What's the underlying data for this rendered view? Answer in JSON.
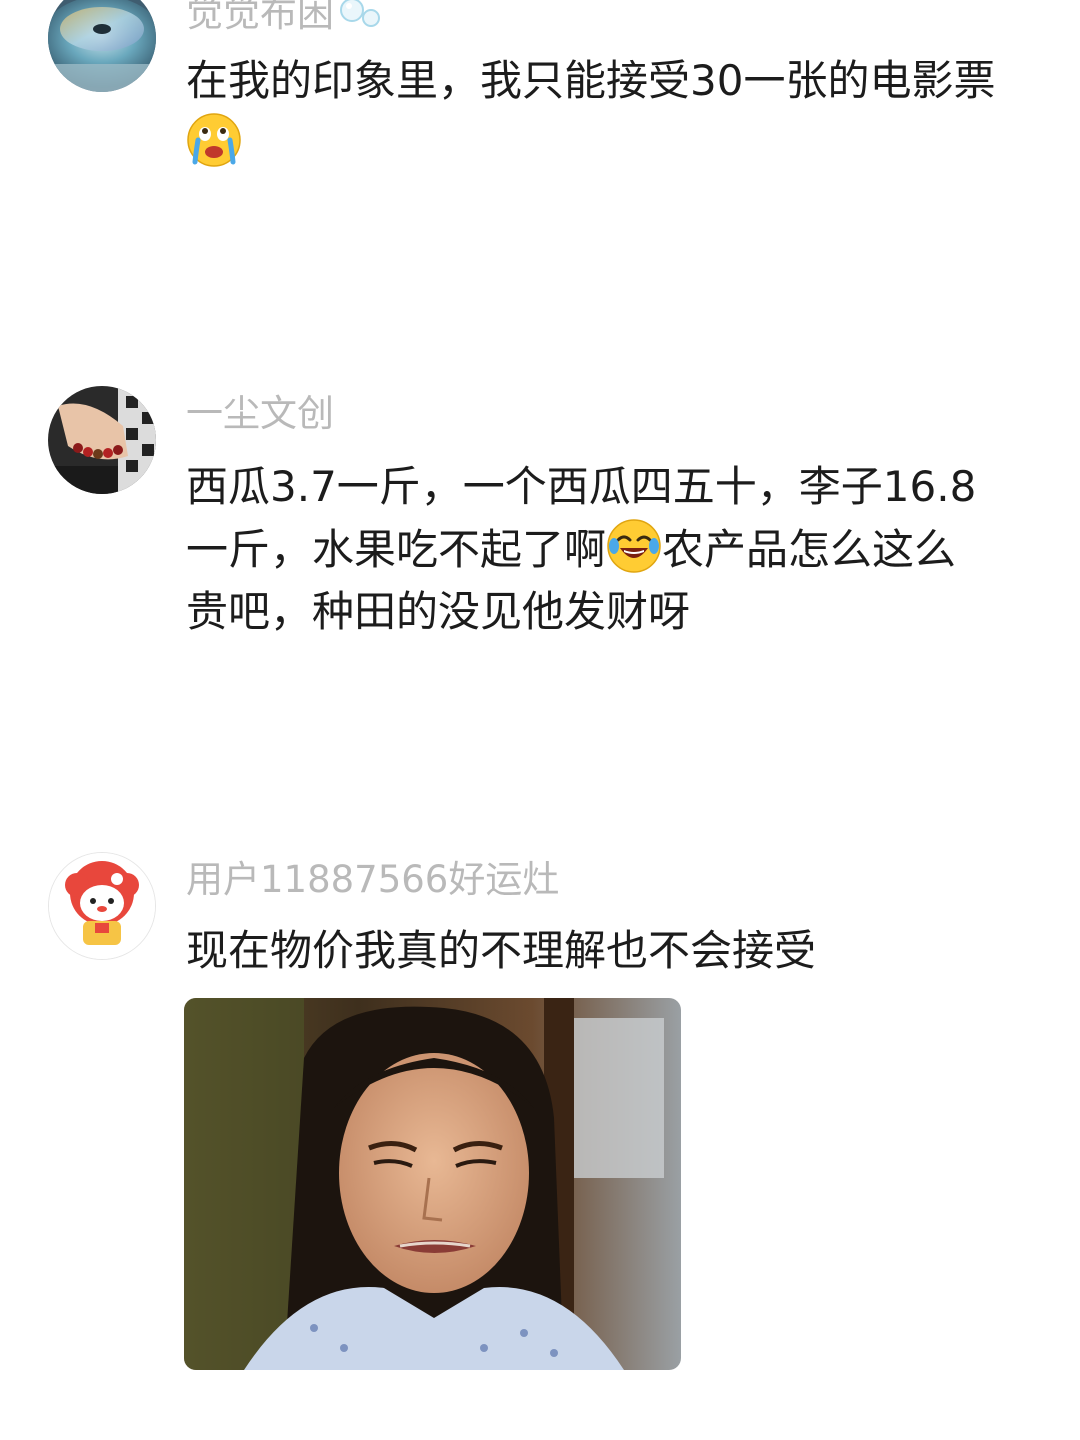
{
  "comments": [
    {
      "username": "觉觉布困",
      "avatar_icon": "cd-disc-avatar",
      "text_before_emoji": "在我的印象里，我只能接受30一张的电影票",
      "emoji_icon": "crying-face-emoji"
    },
    {
      "username": "一尘文创",
      "avatar_icon": "wrist-bracelet-avatar",
      "text_line1": "西瓜3.7一斤，一个西瓜四五十，李子16.8",
      "text_line2_before_emoji": "一斤，水果吃不起了啊",
      "emoji_icon": "laughing-tears-emoji",
      "text_line2_after_emoji": "农产品怎么这么",
      "text_line3": "贵吧，种田的没见他发财呀"
    },
    {
      "username": "用户11887566好运灶",
      "avatar_icon": "cartoon-character-avatar",
      "text": "现在物价我真的不理解也不会接受",
      "image": "grimacing-woman-meme"
    }
  ],
  "colors": {
    "username": "#b9b9b9",
    "text": "#1c1c1c",
    "background": "#ffffff"
  }
}
